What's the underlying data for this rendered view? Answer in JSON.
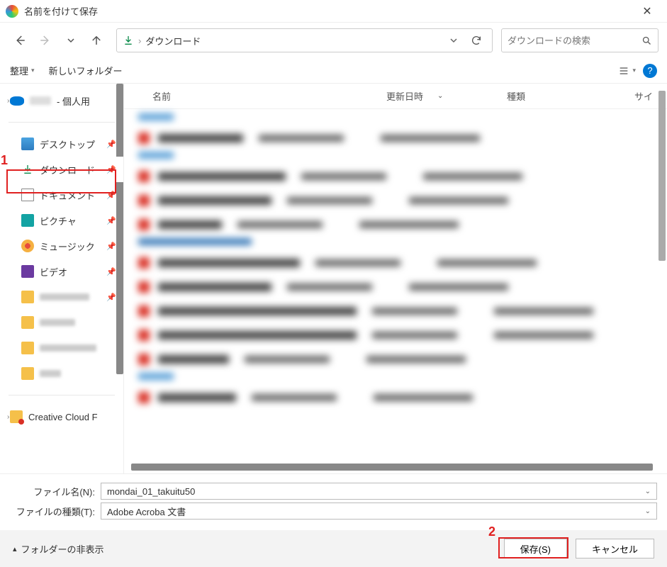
{
  "window": {
    "title": "名前を付けて保存"
  },
  "nav": {
    "location_icon": "download",
    "breadcrumb": "ダウンロード",
    "search_placeholder": "ダウンロードの検索"
  },
  "toolbar": {
    "organize": "整理",
    "new_folder": "新しいフォルダー"
  },
  "sidebar": {
    "onedrive_suffix": "- 個人用",
    "items": [
      {
        "label": "デスクトップ",
        "icon": "desktop"
      },
      {
        "label": "ダウンロード",
        "icon": "download",
        "active": true
      },
      {
        "label": "ドキュメント",
        "icon": "document"
      },
      {
        "label": "ピクチャ",
        "icon": "pictures"
      },
      {
        "label": "ミュージック",
        "icon": "music"
      },
      {
        "label": "ビデオ",
        "icon": "video"
      }
    ],
    "creative_cloud": "Creative Cloud F"
  },
  "columns": {
    "name": "名前",
    "date": "更新日時",
    "type": "種類",
    "size": "サイ"
  },
  "form": {
    "filename_label": "ファイル名(N):",
    "filename_value": "mondai_01_takuitu50",
    "filetype_label": "ファイルの種類(T):",
    "filetype_value": "Adobe Acroba 文書"
  },
  "footer": {
    "hide_folders": "フォルダーの非表示",
    "save": "保存(S)",
    "cancel": "キャンセル"
  },
  "annotations": {
    "one": "1",
    "two": "2"
  }
}
